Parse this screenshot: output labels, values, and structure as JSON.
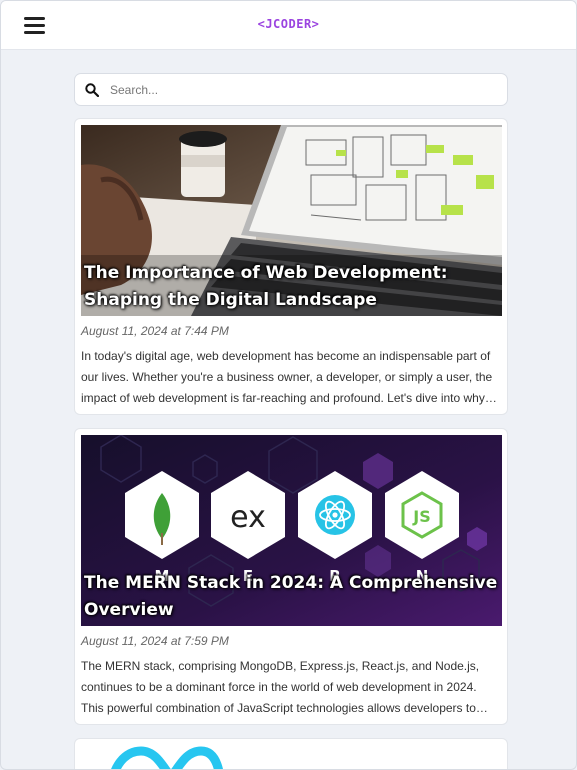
{
  "header": {
    "brand": "<JCODER>",
    "menu_icon": "hamburger-menu-icon"
  },
  "search": {
    "placeholder": "Search...",
    "value": "",
    "icon": "search-icon"
  },
  "posts": [
    {
      "title": "The Importance of Web Development: Shaping the Digital Landscape",
      "date": "August 11, 2024 at 7:44 PM",
      "excerpt": "In today's digital age, web development has become an indispensable part of our lives. Whether you're a business owner, a developer, or simply a user, the impact of web development is far-reaching and profound. Let's dive into why web development matters so much today.",
      "image": "laptop-wireframes-photo"
    },
    {
      "title": "The MERN Stack in 2024: A Comprehensive Overview",
      "date": "August 11, 2024 at 7:59 PM",
      "excerpt": "The MERN stack, comprising MongoDB, Express.js, React.js, and Node.js, continues to be a dominant force in the world of web development in 2024. This powerful combination of JavaScript technologies allows developers to build full-stack applications.",
      "image": "mern-stack-logos",
      "image_letters": [
        "M",
        "E",
        "R",
        "N"
      ],
      "image_ex": "ex"
    },
    {
      "image": "meta-logo-partial"
    }
  ],
  "colors": {
    "brand": "#9b44e0",
    "page_bg": "#eef1f6",
    "card_bg": "#ffffff"
  }
}
